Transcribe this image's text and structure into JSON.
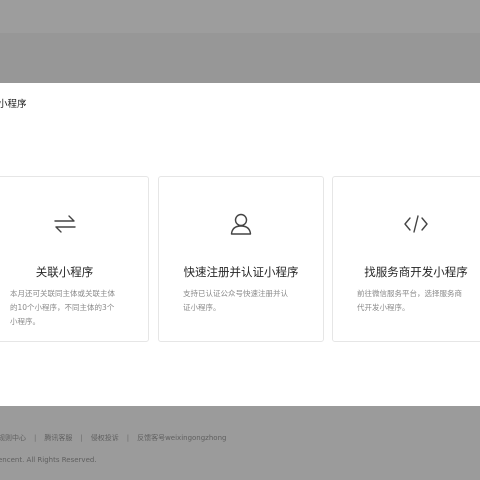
{
  "footer": {
    "links": [
      "规则中心",
      "腾讯客服",
      "侵权投诉",
      "反馈客号weixingongzhong"
    ],
    "copyright": "encent. All Rights Reserved."
  },
  "dialog": {
    "title": "小程序",
    "cards": [
      {
        "icon": "link-arrows-icon",
        "title": "关联小程序",
        "desc_lines": [
          "本月还可关联同主体或关联主体",
          "的10个小程序，不同主体的3个",
          "小程序。"
        ]
      },
      {
        "icon": "user-icon",
        "title": "快速注册并认证小程序",
        "desc_lines": [
          "支持已认证公众号快速注册并认",
          "证小程序。"
        ]
      },
      {
        "icon": "code-icon",
        "title": "找服务商开发小程序",
        "desc_lines": [
          "前往微信服务平台，选择服务商",
          "代开发小程序。"
        ]
      }
    ]
  }
}
